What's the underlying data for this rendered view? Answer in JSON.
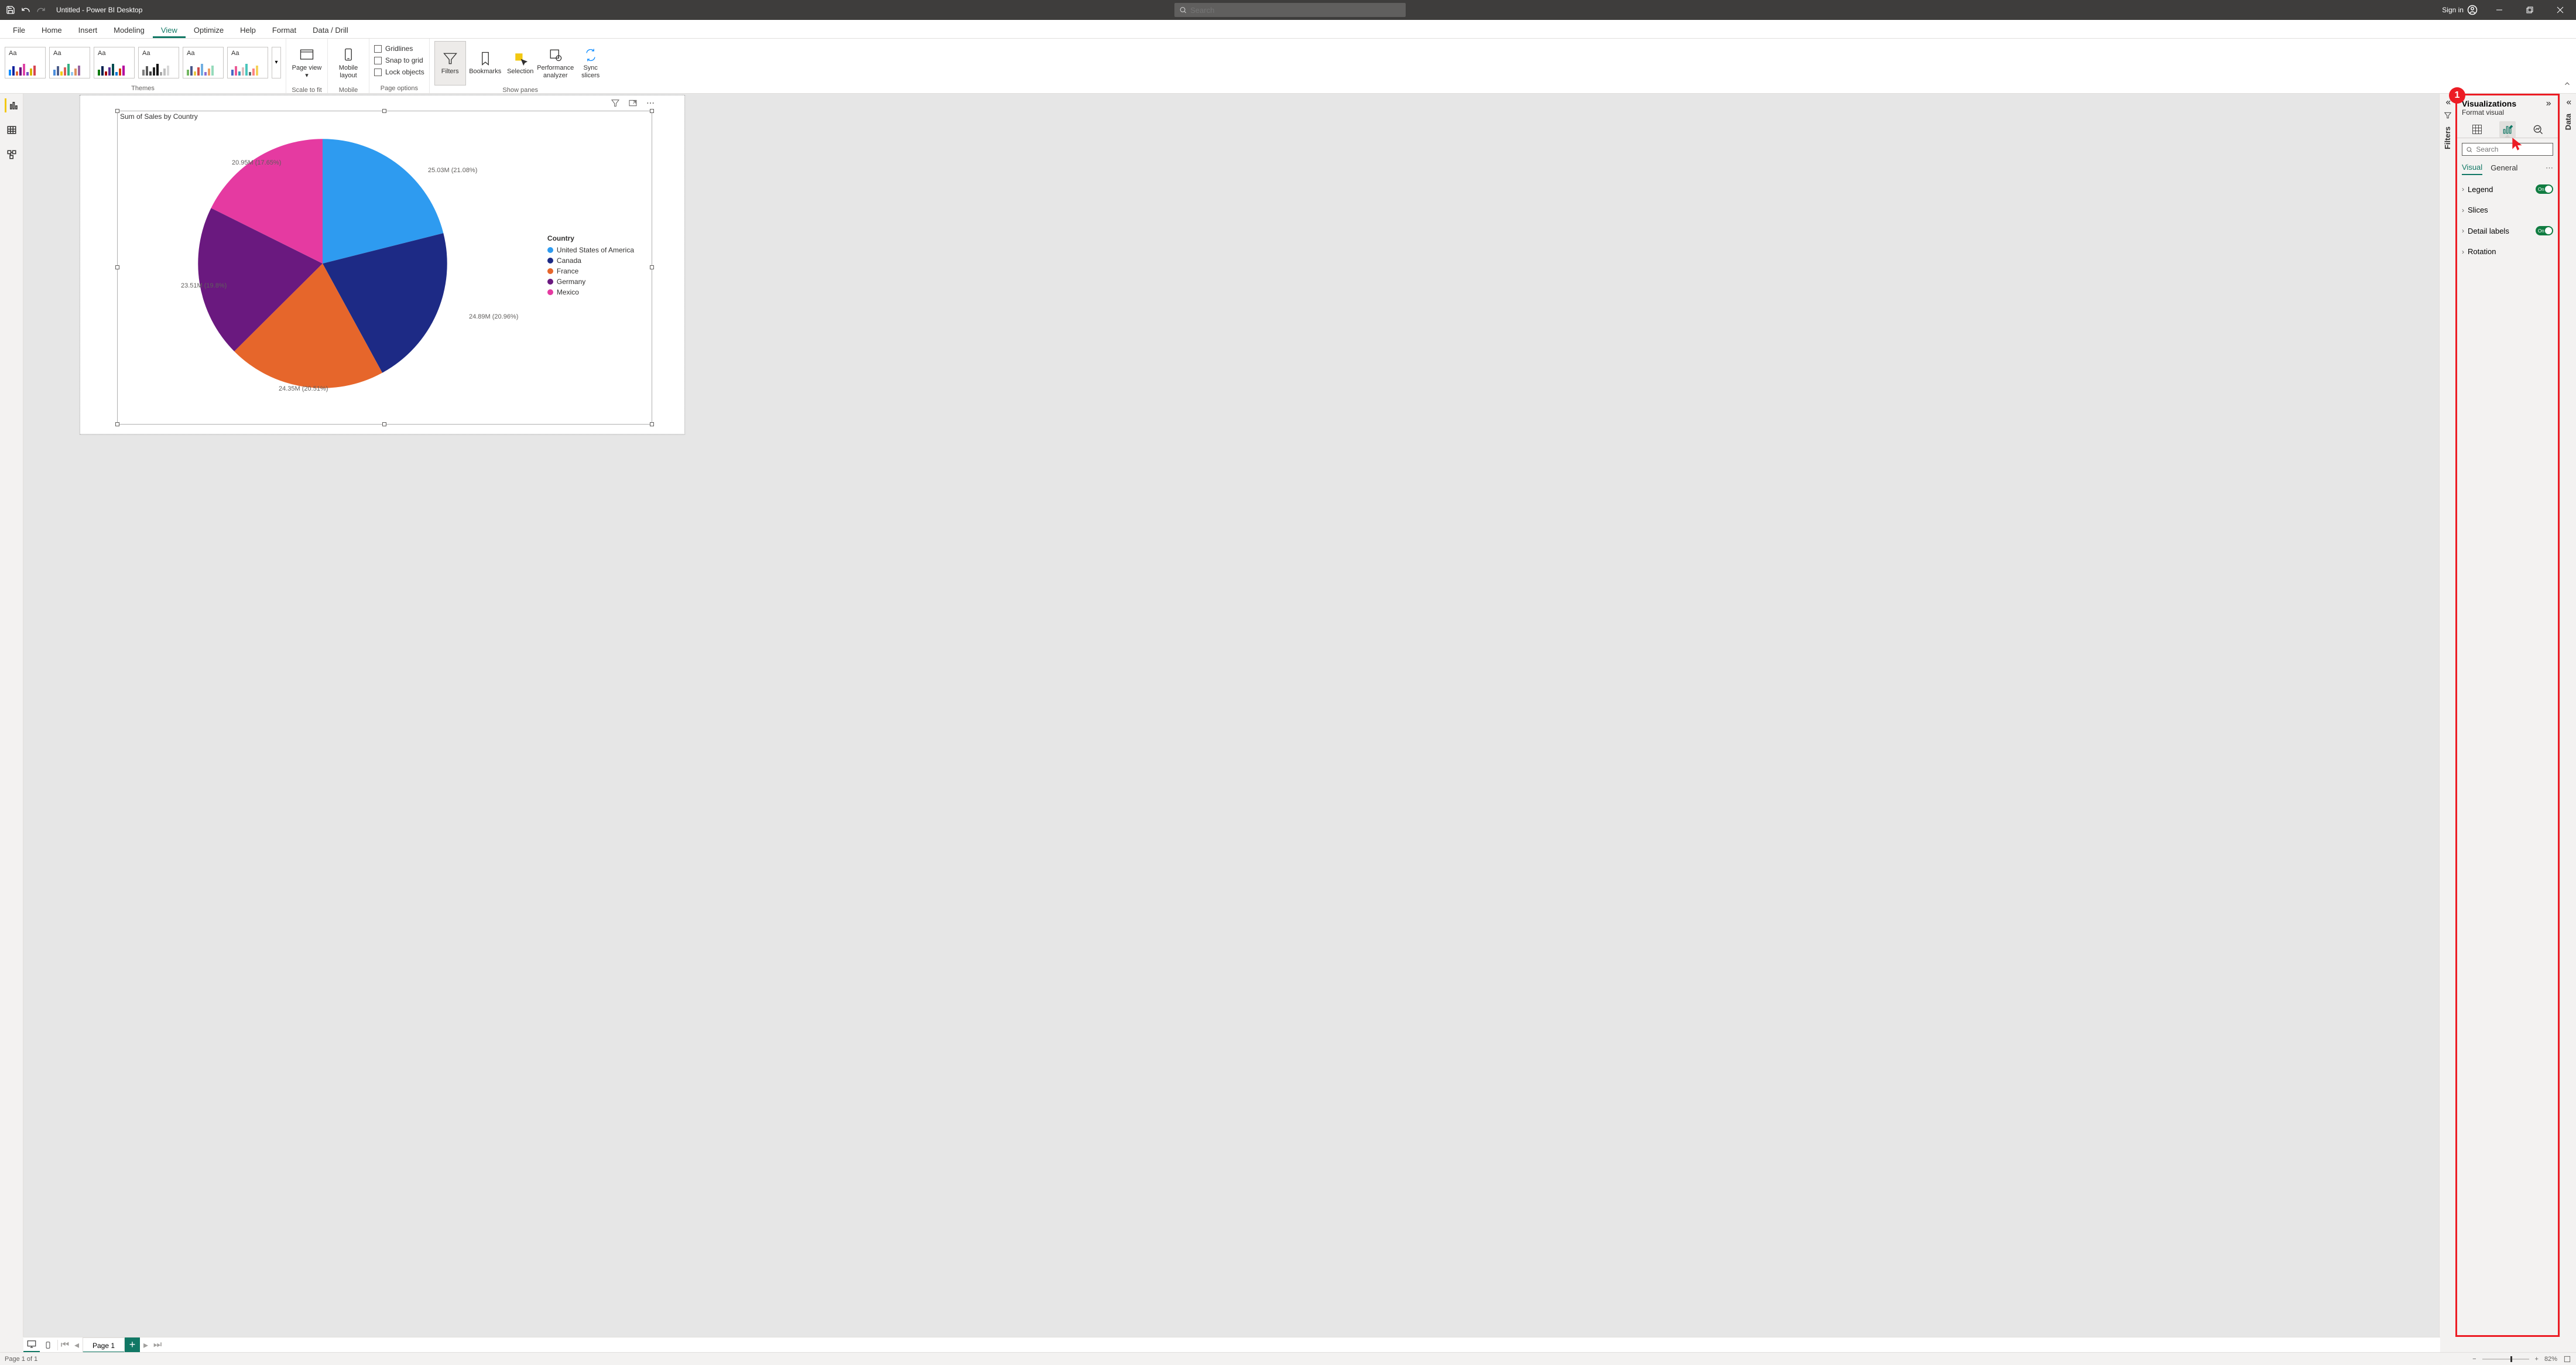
{
  "titlebar": {
    "title": "Untitled - Power BI Desktop",
    "search_placeholder": "Search",
    "signin": "Sign in"
  },
  "ribbon_tabs": [
    "File",
    "Home",
    "Insert",
    "Modeling",
    "View",
    "Optimize",
    "Help",
    "Format",
    "Data / Drill"
  ],
  "ribbon_active_tab": "View",
  "ribbon_groups": {
    "themes": "Themes",
    "scale_to_fit": "Scale to fit",
    "mobile": "Mobile",
    "page_options": "Page options",
    "show_panes": "Show panes"
  },
  "ribbon_buttons": {
    "page_view": "Page view",
    "mobile_layout": "Mobile layout",
    "gridlines": "Gridlines",
    "snap_to_grid": "Snap to grid",
    "lock_objects": "Lock objects",
    "filters": "Filters",
    "bookmarks": "Bookmarks",
    "selection": "Selection",
    "performance_analyzer": "Performance analyzer",
    "sync_slicers": "Sync slicers"
  },
  "panes": {
    "filters": "Filters",
    "visualizations": "Visualizations",
    "format_visual": "Format visual",
    "data": "Data",
    "search_placeholder": "Search",
    "tabs": {
      "visual": "Visual",
      "general": "General"
    },
    "options": {
      "legend": "Legend",
      "slices": "Slices",
      "detail_labels": "Detail labels",
      "rotation": "Rotation",
      "on": "On"
    }
  },
  "callout_number": "1",
  "chart_data": {
    "type": "pie",
    "title": "Sum of Sales by Country",
    "legend_title": "Country",
    "series": [
      {
        "name": "United States of America",
        "value": 25.03,
        "percent": 21.08,
        "label": "25.03M (21.08%)",
        "color": "#2e9bf0"
      },
      {
        "name": "Canada",
        "value": 24.89,
        "percent": 20.96,
        "label": "24.89M (20.96%)",
        "color": "#1d2a85"
      },
      {
        "name": "France",
        "value": 24.35,
        "percent": 20.51,
        "label": "24.35M (20.51%)",
        "color": "#e6662b"
      },
      {
        "name": "Germany",
        "value": 23.51,
        "percent": 19.8,
        "label": "23.51M (19.8%)",
        "color": "#6a197f"
      },
      {
        "name": "Mexico",
        "value": 20.95,
        "percent": 17.65,
        "label": "20.95M (17.65%)",
        "color": "#e53aa1"
      }
    ]
  },
  "page_tabs": {
    "page1": "Page 1"
  },
  "status": {
    "page_of": "Page 1 of 1",
    "zoom": "82%"
  },
  "theme_colors": [
    [
      "#118dff",
      "#12239e",
      "#e66c37",
      "#6b007b",
      "#e044a7",
      "#744ec2",
      "#d9b300",
      "#d64550"
    ],
    [
      "#4a8ddc",
      "#4c5d8a",
      "#f3c911",
      "#dc5b57",
      "#33ae81",
      "#95c8f0",
      "#dd915f",
      "#9a64a0"
    ],
    [
      "#107c10",
      "#002050",
      "#a80000",
      "#5c2e91",
      "#004b50",
      "#0078d4",
      "#d83b01",
      "#b4009e"
    ],
    [
      "#7f7f7f",
      "#595959",
      "#404040",
      "#262626",
      "#0d0d0d",
      "#a6a6a6",
      "#bfbfbf",
      "#d9d9d9"
    ],
    [
      "#73b761",
      "#4a588a",
      "#ecc846",
      "#cd4c46",
      "#71afe2",
      "#8d6fd1",
      "#ee9e64",
      "#95dabb"
    ],
    [
      "#4668c5",
      "#ec5a96",
      "#3599b8",
      "#dfbfbf",
      "#4ac5bb",
      "#5f6b6d",
      "#fb8281",
      "#f4d25a"
    ]
  ]
}
